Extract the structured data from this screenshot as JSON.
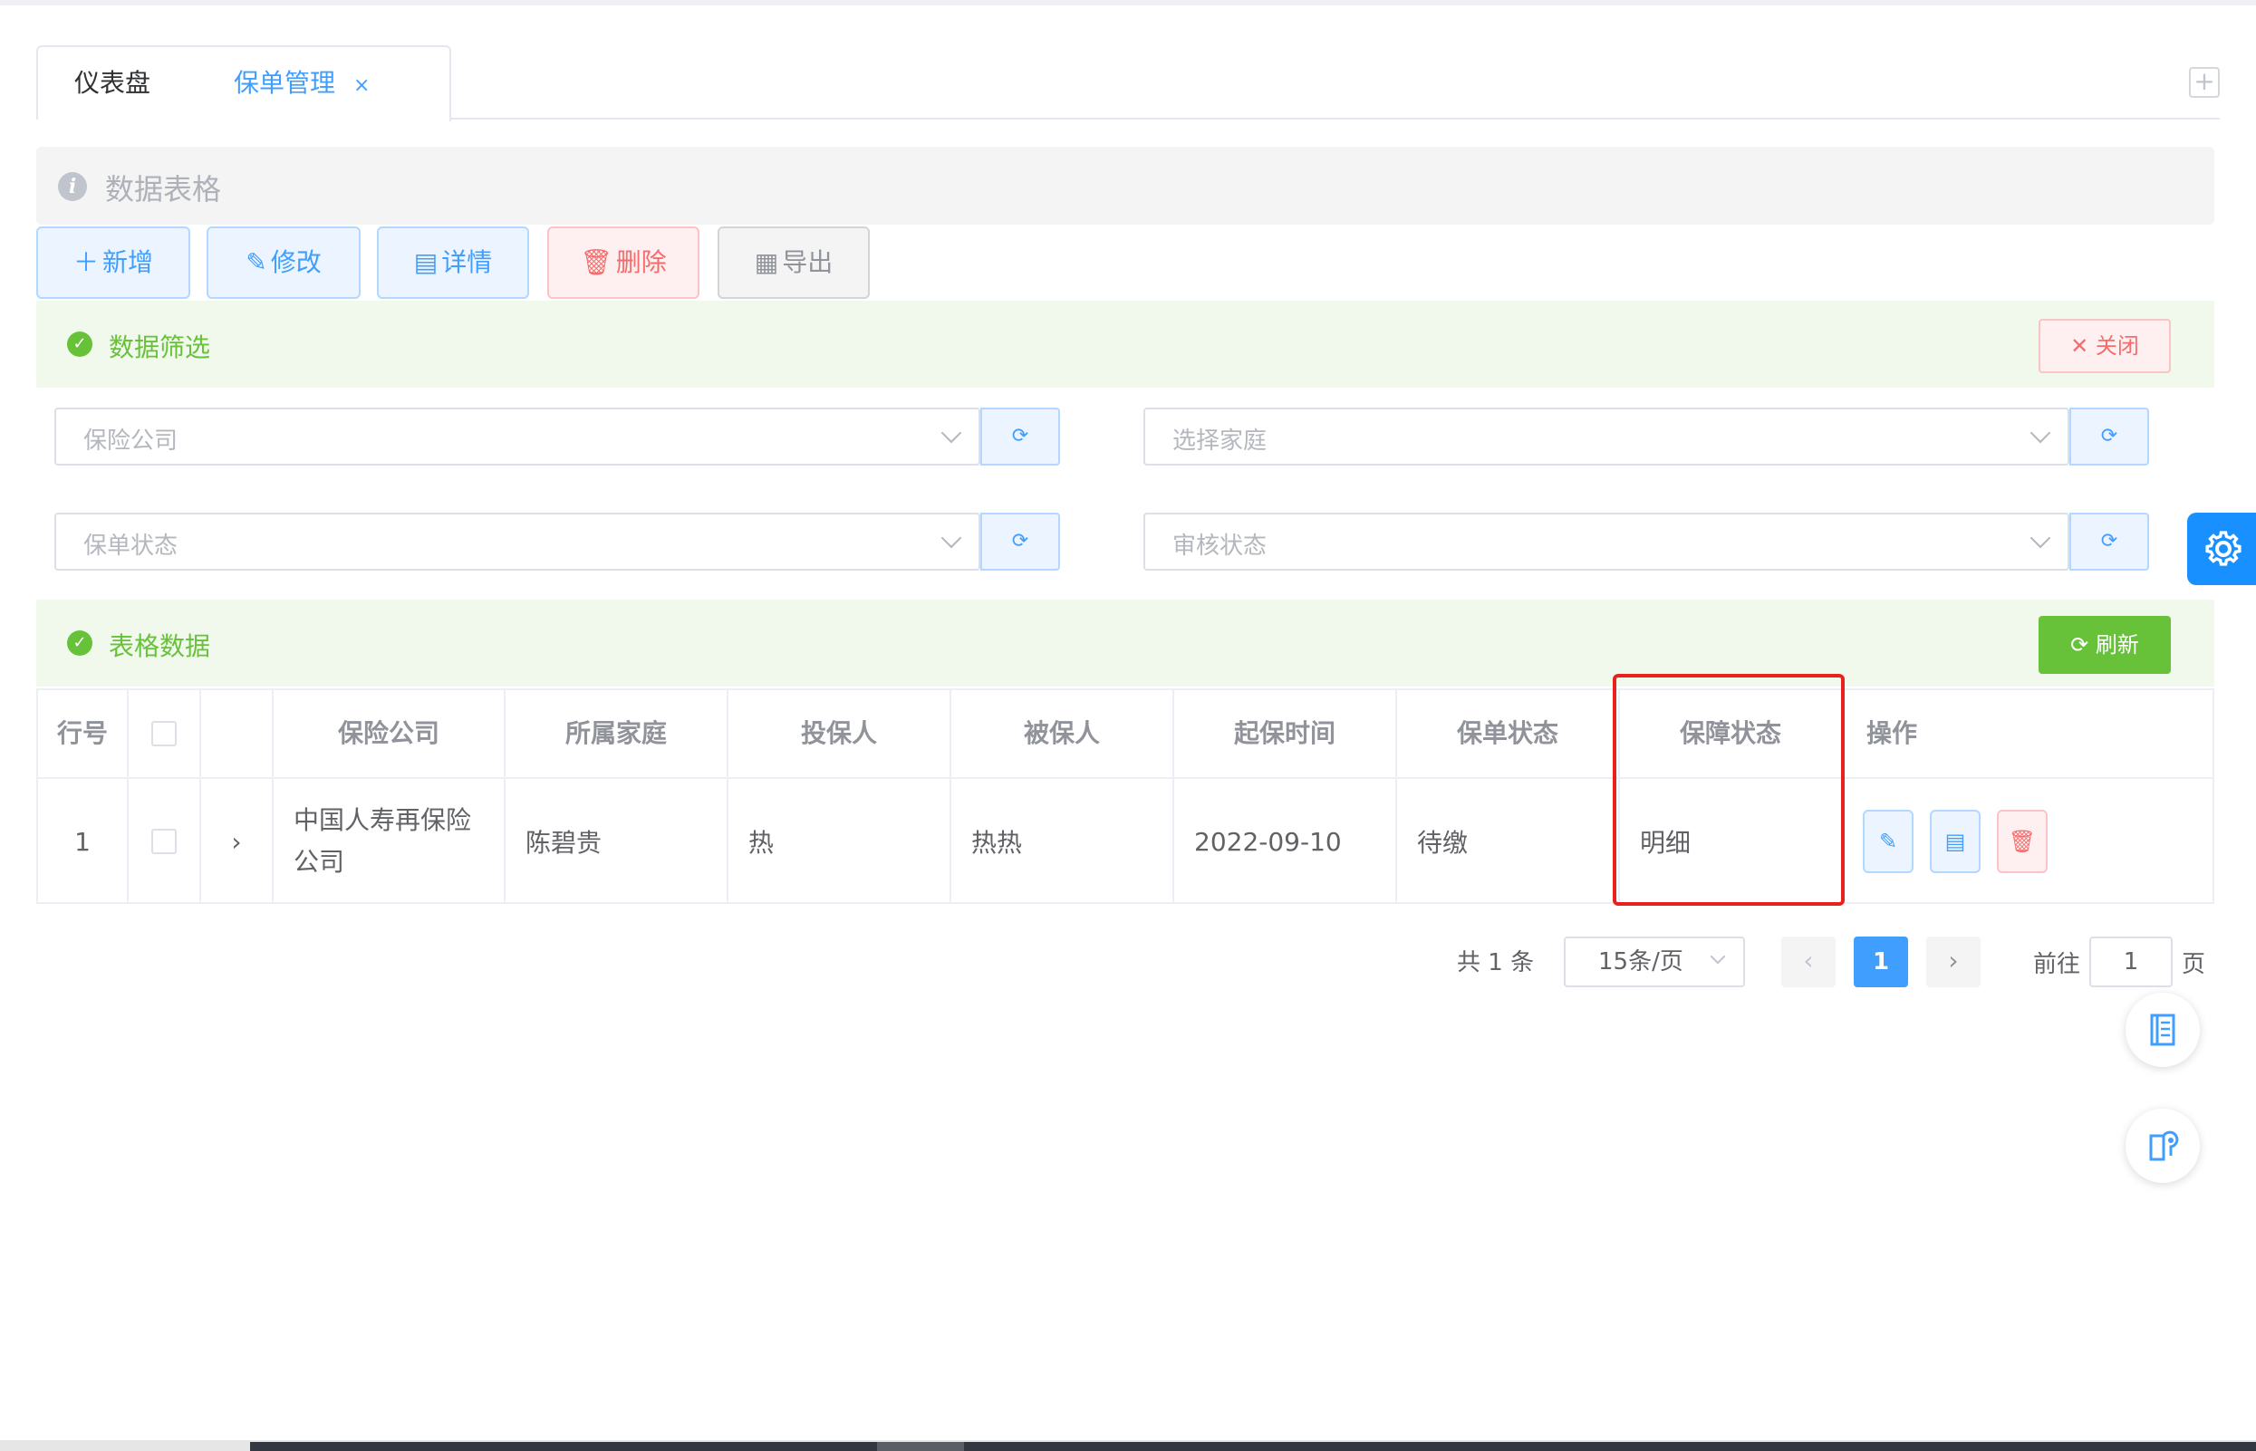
{
  "tabs": [
    {
      "label": "仪表盘"
    },
    {
      "label": "保单管理",
      "close": "×"
    }
  ],
  "tab_add": "+",
  "infobar": {
    "icon": "i",
    "title": "数据表格"
  },
  "toolbar": {
    "add": "新增",
    "edit": "修改",
    "detail": "详情",
    "delete": "删除",
    "export": "导出"
  },
  "filter_section": {
    "title": "数据筛选",
    "close_label": "关闭"
  },
  "filters": [
    {
      "placeholder": "保险公司"
    },
    {
      "placeholder": "选择家庭"
    },
    {
      "placeholder": "保单状态"
    },
    {
      "placeholder": "审核状态"
    }
  ],
  "table_section": {
    "title": "表格数据",
    "refresh_label": "刷新"
  },
  "table": {
    "headers": [
      "行号",
      "",
      "",
      "保险公司",
      "所属家庭",
      "投保人",
      "被保人",
      "起保时间",
      "保单状态",
      "保障状态",
      "操作"
    ],
    "rows": [
      {
        "index": "1",
        "company_line1": "中国人寿再保险",
        "company_line2": "公司",
        "family": "陈碧贵",
        "applicant": "热",
        "insured": "热热",
        "start_date": "2022-09-10",
        "policy_status": "待缴",
        "coverage_status": "明细"
      }
    ]
  },
  "pagination": {
    "total": "共 1 条",
    "page_size": "15条/页",
    "current": "1",
    "goto_label": "前往",
    "goto_value": "1",
    "page_suffix": "页"
  },
  "colors": {
    "primary": "#409eff",
    "success": "#67c23a",
    "danger": "#f56c6c",
    "highlight": "#e8211c"
  }
}
